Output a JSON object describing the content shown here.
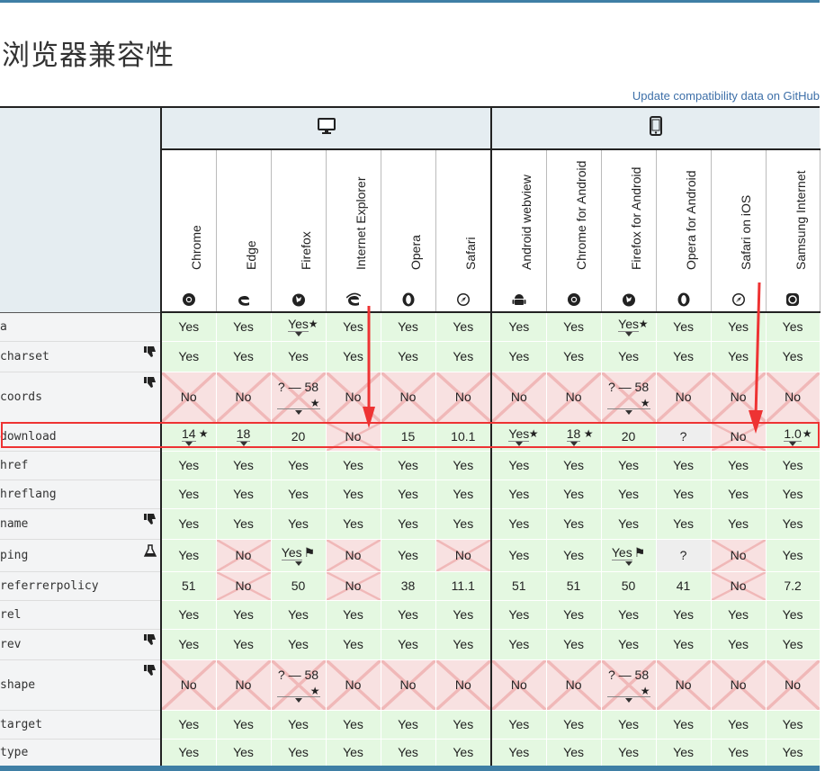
{
  "page": {
    "title": "浏览器兼容性",
    "github_link": "Update compatibility data on GitHub"
  },
  "groups": [
    {
      "name": "desktop-icon",
      "span": 6
    },
    {
      "name": "mobile-icon",
      "span": 6
    }
  ],
  "browsers": [
    {
      "label": "Chrome",
      "icon": "chrome-icon"
    },
    {
      "label": "Edge",
      "icon": "edge-icon"
    },
    {
      "label": "Firefox",
      "icon": "firefox-icon"
    },
    {
      "label": "Internet Explorer",
      "icon": "ie-icon"
    },
    {
      "label": "Opera",
      "icon": "opera-icon"
    },
    {
      "label": "Safari",
      "icon": "safari-icon"
    },
    {
      "label": "Android webview",
      "icon": "android-icon"
    },
    {
      "label": "Chrome for Android",
      "icon": "chrome-icon"
    },
    {
      "label": "Firefox for Android",
      "icon": "firefox-icon"
    },
    {
      "label": "Opera for Android",
      "icon": "opera-icon"
    },
    {
      "label": "Safari on iOS",
      "icon": "safari-icon"
    },
    {
      "label": "Samsung Internet",
      "icon": "samsung-icon"
    }
  ],
  "colors": {
    "yes": "#e4f8e1",
    "no": "#f8e1e1",
    "unknown": "#eeeeee",
    "highlight": "#e33333",
    "accent": "#3f7fa5"
  },
  "rows": [
    {
      "feature": "a",
      "icon": "",
      "cells": [
        {
          "v": "Yes",
          "s": "yes"
        },
        {
          "v": "Yes",
          "s": "yes"
        },
        {
          "v": "Yes",
          "s": "yes",
          "star": true,
          "drop": true
        },
        {
          "v": "Yes",
          "s": "yes"
        },
        {
          "v": "Yes",
          "s": "yes"
        },
        {
          "v": "Yes",
          "s": "yes"
        },
        {
          "v": "Yes",
          "s": "yes"
        },
        {
          "v": "Yes",
          "s": "yes"
        },
        {
          "v": "Yes",
          "s": "yes",
          "star": true,
          "drop": true
        },
        {
          "v": "Yes",
          "s": "yes"
        },
        {
          "v": "Yes",
          "s": "yes"
        },
        {
          "v": "Yes",
          "s": "yes"
        }
      ]
    },
    {
      "feature": "charset",
      "icon": "thumbs-down-icon",
      "cells": [
        {
          "v": "Yes",
          "s": "yes"
        },
        {
          "v": "Yes",
          "s": "yes"
        },
        {
          "v": "Yes",
          "s": "yes"
        },
        {
          "v": "Yes",
          "s": "yes"
        },
        {
          "v": "Yes",
          "s": "yes"
        },
        {
          "v": "Yes",
          "s": "yes"
        },
        {
          "v": "Yes",
          "s": "yes"
        },
        {
          "v": "Yes",
          "s": "yes"
        },
        {
          "v": "Yes",
          "s": "yes"
        },
        {
          "v": "Yes",
          "s": "yes"
        },
        {
          "v": "Yes",
          "s": "yes"
        },
        {
          "v": "Yes",
          "s": "yes"
        }
      ]
    },
    {
      "feature": "coords",
      "icon": "thumbs-down-icon",
      "cells": [
        {
          "v": "No",
          "s": "no"
        },
        {
          "v": "No",
          "s": "no"
        },
        {
          "v": "? — 58",
          "s": "no",
          "star": true,
          "drop": true,
          "tall": true
        },
        {
          "v": "No",
          "s": "no"
        },
        {
          "v": "No",
          "s": "no"
        },
        {
          "v": "No",
          "s": "no"
        },
        {
          "v": "No",
          "s": "no"
        },
        {
          "v": "No",
          "s": "no"
        },
        {
          "v": "? — 58",
          "s": "no",
          "star": true,
          "drop": true,
          "tall": true
        },
        {
          "v": "No",
          "s": "no"
        },
        {
          "v": "No",
          "s": "no"
        },
        {
          "v": "No",
          "s": "no"
        }
      ]
    },
    {
      "feature": "download",
      "icon": "",
      "highlight": true,
      "cells": [
        {
          "v": "14",
          "s": "yes",
          "star": true,
          "drop": true
        },
        {
          "v": "18",
          "s": "yes",
          "drop": true
        },
        {
          "v": "20",
          "s": "yes"
        },
        {
          "v": "No",
          "s": "no"
        },
        {
          "v": "15",
          "s": "yes"
        },
        {
          "v": "10.1",
          "s": "yes"
        },
        {
          "v": "Yes",
          "s": "yes",
          "star": true,
          "drop": true
        },
        {
          "v": "18",
          "s": "yes",
          "star": true,
          "drop": true
        },
        {
          "v": "20",
          "s": "yes"
        },
        {
          "v": "?",
          "s": "unk"
        },
        {
          "v": "No",
          "s": "no"
        },
        {
          "v": "1.0",
          "s": "yes",
          "star": true,
          "drop": true
        }
      ]
    },
    {
      "feature": "href",
      "icon": "",
      "cells": [
        {
          "v": "Yes",
          "s": "yes"
        },
        {
          "v": "Yes",
          "s": "yes"
        },
        {
          "v": "Yes",
          "s": "yes"
        },
        {
          "v": "Yes",
          "s": "yes"
        },
        {
          "v": "Yes",
          "s": "yes"
        },
        {
          "v": "Yes",
          "s": "yes"
        },
        {
          "v": "Yes",
          "s": "yes"
        },
        {
          "v": "Yes",
          "s": "yes"
        },
        {
          "v": "Yes",
          "s": "yes"
        },
        {
          "v": "Yes",
          "s": "yes"
        },
        {
          "v": "Yes",
          "s": "yes"
        },
        {
          "v": "Yes",
          "s": "yes"
        }
      ]
    },
    {
      "feature": "hreflang",
      "icon": "",
      "cells": [
        {
          "v": "Yes",
          "s": "yes"
        },
        {
          "v": "Yes",
          "s": "yes"
        },
        {
          "v": "Yes",
          "s": "yes"
        },
        {
          "v": "Yes",
          "s": "yes"
        },
        {
          "v": "Yes",
          "s": "yes"
        },
        {
          "v": "Yes",
          "s": "yes"
        },
        {
          "v": "Yes",
          "s": "yes"
        },
        {
          "v": "Yes",
          "s": "yes"
        },
        {
          "v": "Yes",
          "s": "yes"
        },
        {
          "v": "Yes",
          "s": "yes"
        },
        {
          "v": "Yes",
          "s": "yes"
        },
        {
          "v": "Yes",
          "s": "yes"
        }
      ]
    },
    {
      "feature": "name",
      "icon": "thumbs-down-icon",
      "cells": [
        {
          "v": "Yes",
          "s": "yes"
        },
        {
          "v": "Yes",
          "s": "yes"
        },
        {
          "v": "Yes",
          "s": "yes"
        },
        {
          "v": "Yes",
          "s": "yes"
        },
        {
          "v": "Yes",
          "s": "yes"
        },
        {
          "v": "Yes",
          "s": "yes"
        },
        {
          "v": "Yes",
          "s": "yes"
        },
        {
          "v": "Yes",
          "s": "yes"
        },
        {
          "v": "Yes",
          "s": "yes"
        },
        {
          "v": "Yes",
          "s": "yes"
        },
        {
          "v": "Yes",
          "s": "yes"
        },
        {
          "v": "Yes",
          "s": "yes"
        }
      ]
    },
    {
      "feature": "ping",
      "icon": "flask-icon",
      "cells": [
        {
          "v": "Yes",
          "s": "yes"
        },
        {
          "v": "No",
          "s": "no"
        },
        {
          "v": "Yes",
          "s": "yes",
          "flag": true,
          "drop": true
        },
        {
          "v": "No",
          "s": "no"
        },
        {
          "v": "Yes",
          "s": "yes"
        },
        {
          "v": "No",
          "s": "no"
        },
        {
          "v": "Yes",
          "s": "yes"
        },
        {
          "v": "Yes",
          "s": "yes"
        },
        {
          "v": "Yes",
          "s": "yes",
          "flag": true,
          "drop": true
        },
        {
          "v": "?",
          "s": "unk"
        },
        {
          "v": "No",
          "s": "no"
        },
        {
          "v": "Yes",
          "s": "yes"
        }
      ]
    },
    {
      "feature": "referrerpolicy",
      "icon": "",
      "cells": [
        {
          "v": "51",
          "s": "yes"
        },
        {
          "v": "No",
          "s": "no"
        },
        {
          "v": "50",
          "s": "yes"
        },
        {
          "v": "No",
          "s": "no"
        },
        {
          "v": "38",
          "s": "yes"
        },
        {
          "v": "11.1",
          "s": "yes"
        },
        {
          "v": "51",
          "s": "yes"
        },
        {
          "v": "51",
          "s": "yes"
        },
        {
          "v": "50",
          "s": "yes"
        },
        {
          "v": "41",
          "s": "yes"
        },
        {
          "v": "No",
          "s": "no"
        },
        {
          "v": "7.2",
          "s": "yes"
        }
      ]
    },
    {
      "feature": "rel",
      "icon": "",
      "cells": [
        {
          "v": "Yes",
          "s": "yes"
        },
        {
          "v": "Yes",
          "s": "yes"
        },
        {
          "v": "Yes",
          "s": "yes"
        },
        {
          "v": "Yes",
          "s": "yes"
        },
        {
          "v": "Yes",
          "s": "yes"
        },
        {
          "v": "Yes",
          "s": "yes"
        },
        {
          "v": "Yes",
          "s": "yes"
        },
        {
          "v": "Yes",
          "s": "yes"
        },
        {
          "v": "Yes",
          "s": "yes"
        },
        {
          "v": "Yes",
          "s": "yes"
        },
        {
          "v": "Yes",
          "s": "yes"
        },
        {
          "v": "Yes",
          "s": "yes"
        }
      ]
    },
    {
      "feature": "rev",
      "icon": "thumbs-down-icon",
      "cells": [
        {
          "v": "Yes",
          "s": "yes"
        },
        {
          "v": "Yes",
          "s": "yes"
        },
        {
          "v": "Yes",
          "s": "yes"
        },
        {
          "v": "Yes",
          "s": "yes"
        },
        {
          "v": "Yes",
          "s": "yes"
        },
        {
          "v": "Yes",
          "s": "yes"
        },
        {
          "v": "Yes",
          "s": "yes"
        },
        {
          "v": "Yes",
          "s": "yes"
        },
        {
          "v": "Yes",
          "s": "yes"
        },
        {
          "v": "Yes",
          "s": "yes"
        },
        {
          "v": "Yes",
          "s": "yes"
        },
        {
          "v": "Yes",
          "s": "yes"
        }
      ]
    },
    {
      "feature": "shape",
      "icon": "thumbs-down-icon",
      "cells": [
        {
          "v": "No",
          "s": "no"
        },
        {
          "v": "No",
          "s": "no"
        },
        {
          "v": "? — 58",
          "s": "no",
          "star": true,
          "drop": true,
          "tall": true
        },
        {
          "v": "No",
          "s": "no"
        },
        {
          "v": "No",
          "s": "no"
        },
        {
          "v": "No",
          "s": "no"
        },
        {
          "v": "No",
          "s": "no"
        },
        {
          "v": "No",
          "s": "no"
        },
        {
          "v": "? — 58",
          "s": "no",
          "star": true,
          "drop": true,
          "tall": true
        },
        {
          "v": "No",
          "s": "no"
        },
        {
          "v": "No",
          "s": "no"
        },
        {
          "v": "No",
          "s": "no"
        }
      ]
    },
    {
      "feature": "target",
      "icon": "",
      "cells": [
        {
          "v": "Yes",
          "s": "yes"
        },
        {
          "v": "Yes",
          "s": "yes"
        },
        {
          "v": "Yes",
          "s": "yes"
        },
        {
          "v": "Yes",
          "s": "yes"
        },
        {
          "v": "Yes",
          "s": "yes"
        },
        {
          "v": "Yes",
          "s": "yes"
        },
        {
          "v": "Yes",
          "s": "yes"
        },
        {
          "v": "Yes",
          "s": "yes"
        },
        {
          "v": "Yes",
          "s": "yes"
        },
        {
          "v": "Yes",
          "s": "yes"
        },
        {
          "v": "Yes",
          "s": "yes"
        },
        {
          "v": "Yes",
          "s": "yes"
        }
      ]
    },
    {
      "feature": "type",
      "icon": "",
      "cells": [
        {
          "v": "Yes",
          "s": "yes"
        },
        {
          "v": "Yes",
          "s": "yes"
        },
        {
          "v": "Yes",
          "s": "yes"
        },
        {
          "v": "Yes",
          "s": "yes"
        },
        {
          "v": "Yes",
          "s": "yes"
        },
        {
          "v": "Yes",
          "s": "yes"
        },
        {
          "v": "Yes",
          "s": "yes"
        },
        {
          "v": "Yes",
          "s": "yes"
        },
        {
          "v": "Yes",
          "s": "yes"
        },
        {
          "v": "Yes",
          "s": "yes"
        },
        {
          "v": "Yes",
          "s": "yes"
        },
        {
          "v": "Yes",
          "s": "yes"
        }
      ]
    }
  ]
}
